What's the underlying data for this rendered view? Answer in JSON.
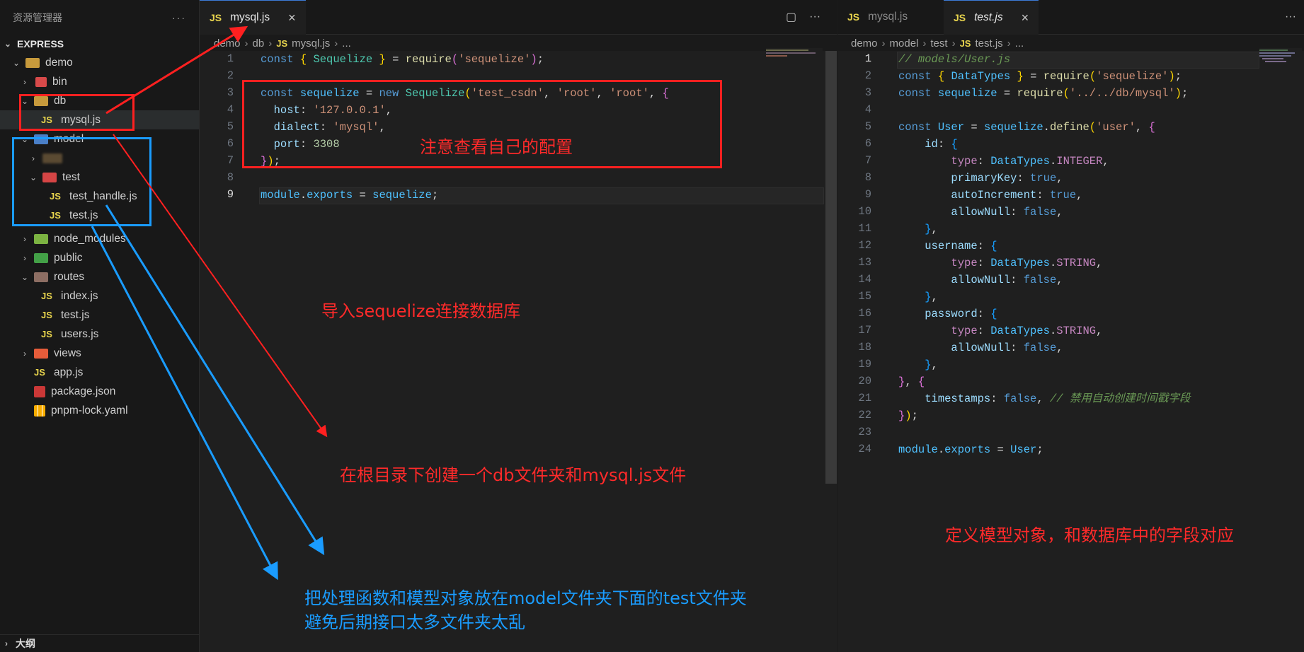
{
  "explorer": {
    "title": "资源管理器",
    "more": "···",
    "root": "EXPRESS",
    "outline": "大纲",
    "items": [
      {
        "label": "demo"
      },
      {
        "label": "bin"
      },
      {
        "label": "db"
      },
      {
        "label": "mysql.js"
      },
      {
        "label": "model"
      },
      {
        "label": ""
      },
      {
        "label": "test"
      },
      {
        "label": "test_handle.js"
      },
      {
        "label": "test.js"
      },
      {
        "label": "node_modules"
      },
      {
        "label": "public"
      },
      {
        "label": "routes"
      },
      {
        "label": "index.js"
      },
      {
        "label": "test.js"
      },
      {
        "label": "users.js"
      },
      {
        "label": "views"
      },
      {
        "label": "app.js"
      },
      {
        "label": "package.json"
      },
      {
        "label": "pnpm-lock.yaml"
      }
    ]
  },
  "left_editor": {
    "tab": {
      "icon": "JS",
      "label": "mysql.js",
      "close": "×"
    },
    "actions": {
      "split": "▢",
      "more": "···"
    },
    "breadcrumb": [
      "demo",
      "db",
      "mysql.js",
      "..."
    ],
    "line_numbers": [
      "1",
      "2",
      "3",
      "4",
      "5",
      "6",
      "7",
      "8",
      "9"
    ]
  },
  "right_editor": {
    "tabs": [
      {
        "icon": "JS",
        "label": "mysql.js"
      },
      {
        "icon": "JS",
        "label": "test.js",
        "close": "×"
      }
    ],
    "more": "···",
    "breadcrumb": [
      "demo",
      "model",
      "test",
      "test.js",
      "..."
    ],
    "line_numbers": [
      "1",
      "2",
      "3",
      "4",
      "5",
      "6",
      "7",
      "8",
      "9",
      "10",
      "11",
      "12",
      "13",
      "14",
      "15",
      "16",
      "17",
      "18",
      "19",
      "20",
      "21",
      "22",
      "23",
      "24"
    ]
  },
  "annotations": {
    "config_note": "注意查看自己的配置",
    "import_note": "导入sequelize连接数据库",
    "create_note": "在根目录下创建一个db文件夹和mysql.js文件",
    "model_note_line1": "把处理函数和模型对象放在model文件夹下面的test文件夹",
    "model_note_line2": "避免后期接口太多文件夹太乱",
    "define_note": "定义模型对象，和数据库中的字段对应"
  },
  "colors": {
    "annotation_red": "#ff2a2a",
    "annotation_blue": "#1a9cff",
    "js_icon": "#e8d44d",
    "folder": "#c79a3c"
  }
}
